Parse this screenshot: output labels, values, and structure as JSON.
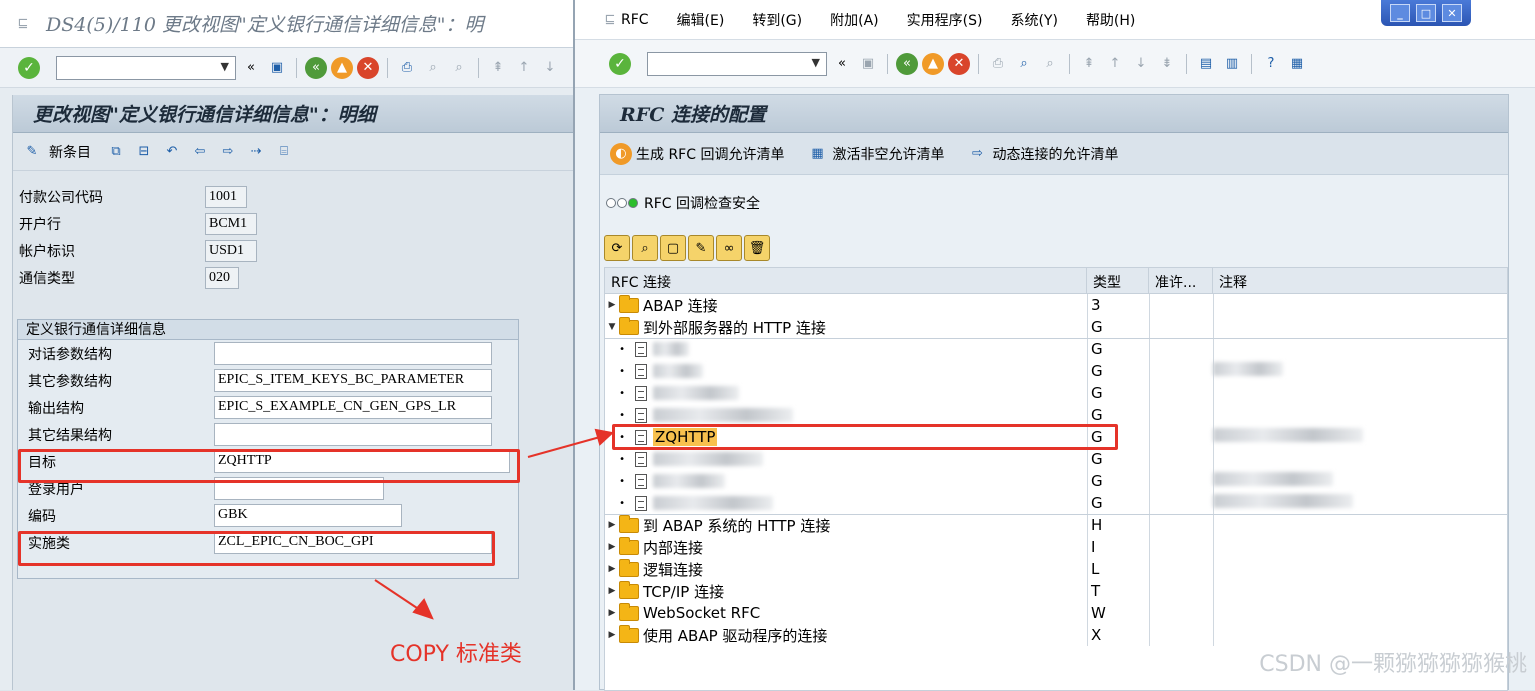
{
  "left_window": {
    "title": "DS4(5)/110 更改视图\"定义银行通信详细信息\"：明",
    "panel_title": "更改视图\"定义银行通信详细信息\"：明细",
    "new_entries_label": "新条目",
    "header_fields": [
      {
        "label": "付款公司代码",
        "value": "1001"
      },
      {
        "label": "开户行",
        "value": "BCM1"
      },
      {
        "label": "帐户标识",
        "value": "USD1"
      },
      {
        "label": "通信类型",
        "value": "020"
      }
    ],
    "group_title": "定义银行通信详细信息",
    "group_fields": [
      {
        "label": "对话参数结构",
        "value": ""
      },
      {
        "label": "其它参数结构",
        "value": "EPIC_S_ITEM_KEYS_BC_PARAMETER"
      },
      {
        "label": "输出结构",
        "value": "EPIC_S_EXAMPLE_CN_GEN_GPS_LR"
      },
      {
        "label": "其它结果结构",
        "value": ""
      },
      {
        "label": "目标",
        "value": "ZQHTTP"
      },
      {
        "label": "登录用户",
        "value": ""
      },
      {
        "label": "编码",
        "value": "GBK"
      },
      {
        "label": "实施类",
        "value": "ZCL_EPIC_CN_BOC_GPI"
      }
    ]
  },
  "right_window": {
    "menu": [
      "RFC",
      "编辑(E)",
      "转到(G)",
      "附加(A)",
      "实用程序(S)",
      "系统(Y)",
      "帮助(H)"
    ],
    "panel_title": "RFC 连接的配置",
    "actions": [
      "生成 RFC 回调允许清单",
      "激活非空允许清单",
      "动态连接的允许清单"
    ],
    "security_check": "RFC 回调检查安全",
    "columns": [
      "RFC 连接",
      "类型",
      "准许...",
      "注释"
    ],
    "tree": {
      "abap": {
        "label": "ABAP 连接",
        "type": "3"
      },
      "http_ext": {
        "label": "到外部服务器的 HTTP 连接",
        "type": "G"
      },
      "http_children_types": [
        "G",
        "G",
        "G",
        "G",
        "G",
        "G",
        "G",
        "G"
      ],
      "selected_child": "ZQHTTP",
      "http_abap": {
        "label": "到 ABAP 系统的 HTTP 连接",
        "type": "H"
      },
      "internal": {
        "label": "内部连接",
        "type": "I"
      },
      "logical": {
        "label": "逻辑连接",
        "type": "L"
      },
      "tcpip": {
        "label": "TCP/IP 连接",
        "type": "T"
      },
      "websocket": {
        "label": "WebSocket RFC",
        "type": "W"
      },
      "abap_driver": {
        "label": "使用 ABAP 驱动程序的连接",
        "type": "X"
      }
    }
  },
  "annotation": {
    "copy_label": "COPY 标准类",
    "color": "#e53329"
  },
  "watermark": "CSDN @一颗猕猕猕猕猴桃"
}
